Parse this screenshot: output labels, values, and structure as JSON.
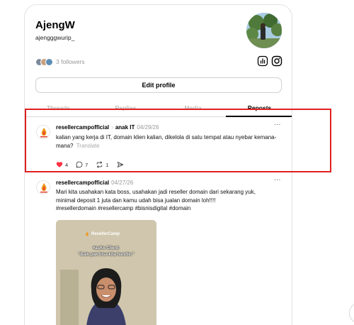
{
  "profile": {
    "display_name": "AjengW",
    "username": "ajengggwurip_",
    "followers_text": "3 followers",
    "edit_profile_label": "Edit profile",
    "insights_icon": "bar-chart-icon",
    "instagram_icon": "instagram-icon"
  },
  "tabs": [
    {
      "label": "Threads",
      "active": false
    },
    {
      "label": "Replies",
      "active": false
    },
    {
      "label": "Media",
      "active": false
    },
    {
      "label": "Reposts",
      "active": true
    }
  ],
  "posts": [
    {
      "username": "resellercampofficial",
      "tagged": "anak IT",
      "date": "04/29/26",
      "text": "kalian yang kerja di IT, domain klien kalian, dikelola di satu tempat atau nyebar kemana-mana?",
      "translate_label": "Translate",
      "likes": "4",
      "replies": "7",
      "reposts": "1",
      "liked": true,
      "more": "..."
    },
    {
      "username": "resellercampofficial",
      "date": "04/27/26",
      "text_lines": [
        "Mari kita usahakan kata boss, usahakan jadi reseller domain dari sekarang yuk,",
        "minimal deposit 1 juta dan kamu udah bisa jualan domain loh!!!!",
        "#resellerdomain #resellercamp #bisnisdigital #domain"
      ],
      "more": "...",
      "media": {
        "logo_text": "ResellerCamp",
        "caption_line1": "#asKe Client:",
        "caption_line2": "\"Baik pak bisa kita handle.\""
      }
    }
  ],
  "colors": {
    "highlight": "#e02020",
    "like": "#ff3040"
  }
}
